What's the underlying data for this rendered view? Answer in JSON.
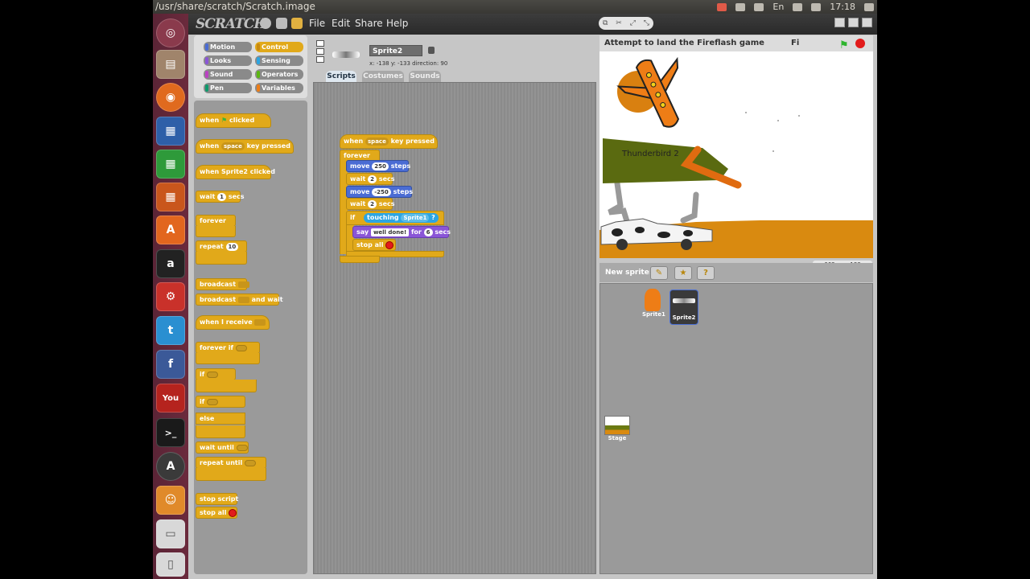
{
  "topbar": {
    "title": "/usr/share/scratch/Scratch.image",
    "lang": "En",
    "time": "17:18"
  },
  "menubar": {
    "logo": "SCRATCH",
    "file": "File",
    "edit": "Edit",
    "share": "Share",
    "help": "Help"
  },
  "categories": {
    "motion": "Motion",
    "control": "Control",
    "looks": "Looks",
    "sensing": "Sensing",
    "sound": "Sound",
    "operators": "Operators",
    "pen": "Pen",
    "variables": "Variables"
  },
  "palette": {
    "when_flag": "when",
    "clicked": "clicked",
    "when_key": "when",
    "key_val": "space",
    "key_pressed": "key pressed",
    "when_sprite_clicked": "when Sprite2 clicked",
    "wait": "wait",
    "wait_val": "1",
    "secs": "secs",
    "forever": "forever",
    "repeat": "repeat",
    "repeat_val": "10",
    "broadcast": "broadcast",
    "broadcast_wait": "broadcast",
    "and_wait": "and wait",
    "when_receive": "when I receive",
    "forever_if": "forever if",
    "if1": "if",
    "if2": "if",
    "else": "else",
    "wait_until": "wait until",
    "repeat_until": "repeat until",
    "stop_script": "stop script",
    "stop_all": "stop all"
  },
  "sprite_info": {
    "name": "Sprite2",
    "coords": "x: -138  y: -133  direction: 90"
  },
  "tabs": {
    "scripts": "Scripts",
    "costumes": "Costumes",
    "sounds": "Sounds"
  },
  "script": {
    "when": "when",
    "key": "space",
    "key_pressed": "key pressed",
    "forever": "forever",
    "move1": "move",
    "move1_val": "250",
    "steps1": "steps",
    "wait1": "wait",
    "wait1_val": "2",
    "secs1": "secs",
    "move2": "move",
    "move2_val": "-250",
    "steps2": "steps",
    "wait2": "wait",
    "wait2_val": "2",
    "secs2": "secs",
    "if": "if",
    "touching": "touching",
    "touching_val": "Sprite1",
    "q": "?",
    "say": "say",
    "say_val": "well done!",
    "for": "for",
    "for_val": "6",
    "secs3": "secs",
    "stop_all": "stop all"
  },
  "stage": {
    "title": "Attempt to land the Fireflash game",
    "fi": "Fi",
    "label": "Thunderbird 2",
    "coords_x": "x: -663",
    "coords_y": "y: -138"
  },
  "sprites": {
    "new_sprite": "New sprite:",
    "s1": "Sprite1",
    "s2": "Sprite2",
    "stage": "Stage"
  },
  "colors": {
    "control": "#e1a91a",
    "motion": "#4a6cd4",
    "looks": "#8a55d7",
    "sensing": "#2ca5e2",
    "accent_stage_bg": "#ffffff"
  }
}
